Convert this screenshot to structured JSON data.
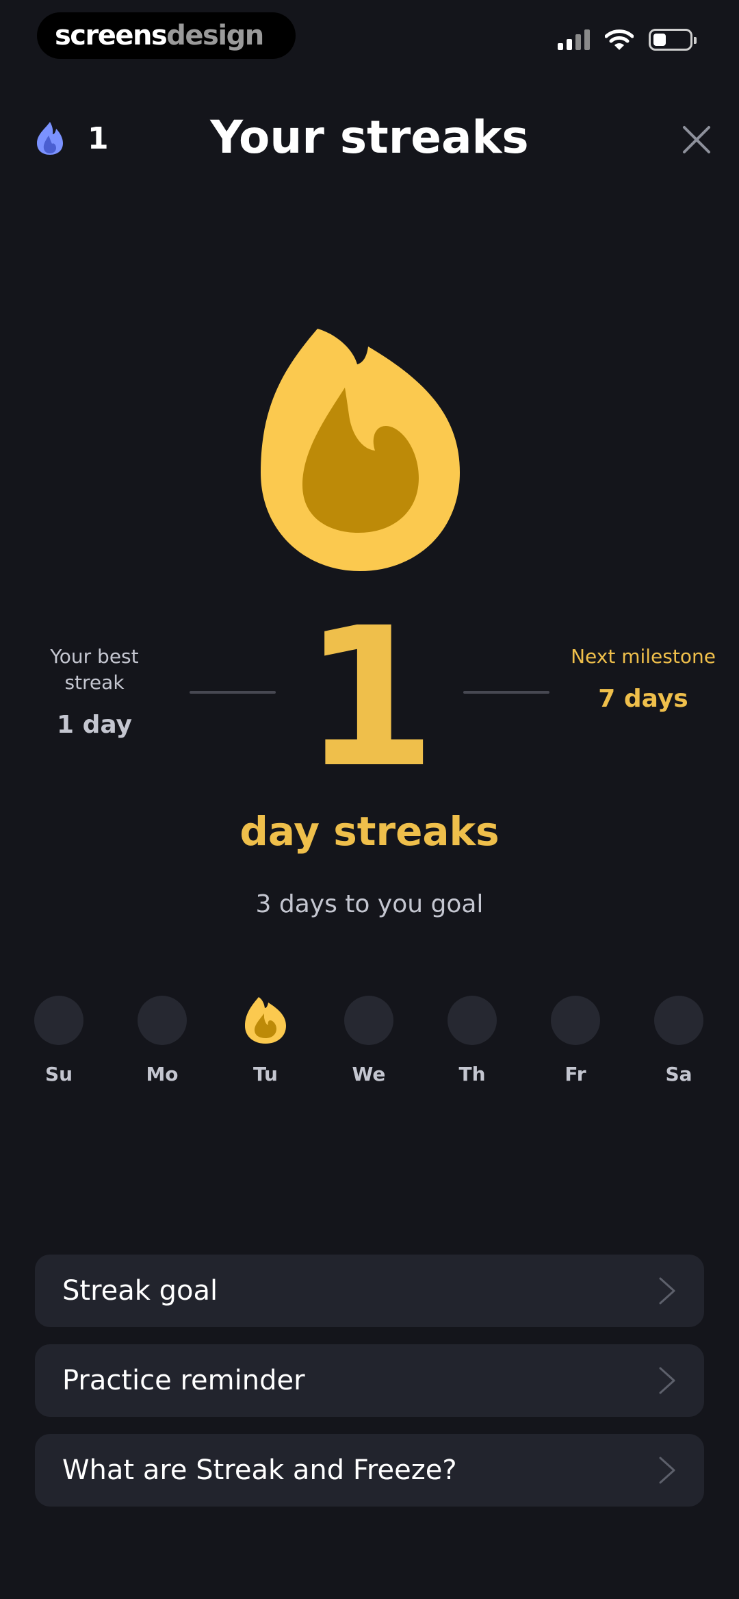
{
  "status_bar": {
    "brand_part1": "screens",
    "brand_part2": "design"
  },
  "header": {
    "streak_count": "1",
    "title": "Your streaks",
    "close_icon": "close-icon",
    "streak_icon": "blue-flame-icon"
  },
  "hero": {
    "flame_icon": "flame-icon",
    "best_label": "Your best streak",
    "best_value": "1 day",
    "current_number": "1",
    "unit_label": "day streaks",
    "next_label": "Next milestone",
    "next_value": "7 days",
    "goal_text": "3 days to you goal"
  },
  "week": {
    "days": [
      {
        "label": "Su",
        "active": false
      },
      {
        "label": "Mo",
        "active": false
      },
      {
        "label": "Tu",
        "active": true
      },
      {
        "label": "We",
        "active": false
      },
      {
        "label": "Th",
        "active": false
      },
      {
        "label": "Fr",
        "active": false
      },
      {
        "label": "Sa",
        "active": false
      }
    ]
  },
  "options": [
    {
      "label": "Streak goal"
    },
    {
      "label": "Practice reminder"
    },
    {
      "label": "What are Streak and Freeze?"
    }
  ],
  "colors": {
    "background": "#14151b",
    "accent": "#efbf4b",
    "flame_outer": "#fbc94f",
    "flame_inner": "#bd8a08",
    "blue_flame": "#7b92ff",
    "card": "#22242d"
  }
}
